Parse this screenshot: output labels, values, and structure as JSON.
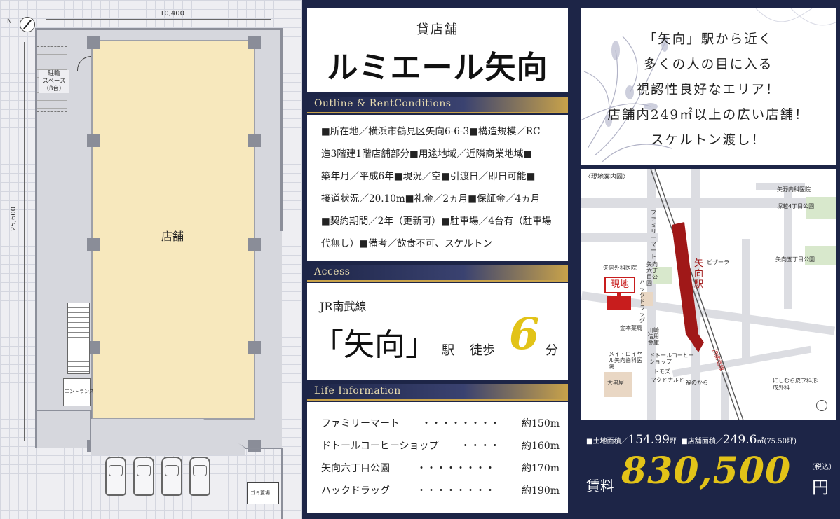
{
  "floorplan": {
    "width_dim": "10,400",
    "height_dim": "25,600",
    "store_label": "店舗",
    "parking_label": [
      "駐輪",
      "スペース",
      "（8台）"
    ],
    "entrance_label": "エントランス",
    "garbage_label": "ゴミ置場",
    "compass": "N"
  },
  "header": {
    "subtitle": "貸店舗",
    "title": "ルミエール矢向"
  },
  "outline": {
    "band_label": "Outline & RentConditions",
    "lines": [
      "■所在地／横浜市鶴見区矢向6-6-3■構造規模／RC",
      "造3階建1階店舗部分■用途地域／近隣商業地域■",
      "築年月／平成6年■現況／空■引渡日／即日可能■",
      "接道状況／20.10m■礼金／2ヵ月■保証金／4ヵ月",
      "■契約期間／2年（更新可）■駐車場／4台有（駐車場",
      "代無し）■備考／飲食不可、スケルトン"
    ]
  },
  "access": {
    "band_label": "Access",
    "line_name": "JR南武線",
    "station": "「矢向」",
    "station_suffix": "駅",
    "walk": "徒歩",
    "minutes": "6",
    "minutes_unit": "分"
  },
  "life": {
    "band_label": "Life Information",
    "items": [
      {
        "name": "ファミリーマート",
        "dots": "・・・・・・・・",
        "dist": "約150m"
      },
      {
        "name": "ドトールコーヒーショップ",
        "dots": "・・・・",
        "dist": "約160m"
      },
      {
        "name": "矢向六丁目公園",
        "dots": "・・・・・・・・",
        "dist": "約170m"
      },
      {
        "name": "ハックドラッグ",
        "dots": "・・・・・・・・",
        "dist": "約190m"
      }
    ]
  },
  "slogan": {
    "lines": [
      "「矢向」駅から近く",
      "多くの人の目に入る",
      "視認性良好なエリア！",
      "店舗内249㎡以上の広い店舗！",
      "スケルトン渡し！"
    ]
  },
  "map": {
    "title": "〈現地案内図〉",
    "site_label": "現地",
    "station_label": "矢向駅",
    "rail_label": "JR南武線",
    "places": [
      "矢野内科医院",
      "塚越4丁目公園",
      "ファミリーマート",
      "ピザーラ",
      "矢向五丁目公園",
      "矢向外科医院",
      "矢向六丁目公園",
      "ハックドラッグ",
      "金本薬局",
      "川崎信用金庫",
      "メイ・ロイヤル矢向歯科医院",
      "ドトールコーヒーショップ",
      "トモズ",
      "マクドナルド",
      "福のから",
      "大黒屋",
      "にしむら皮フ科形成外科"
    ]
  },
  "price": {
    "land_label": "■土地面積／",
    "land_value": "154.99",
    "land_unit": "坪",
    "store_label": "■店舗面積／",
    "store_value": "249.6",
    "store_unit": "㎡(75.50坪)",
    "rent_label": "賃料",
    "rent_value": "830,500",
    "tax": "（税込）",
    "yen": "円"
  }
}
